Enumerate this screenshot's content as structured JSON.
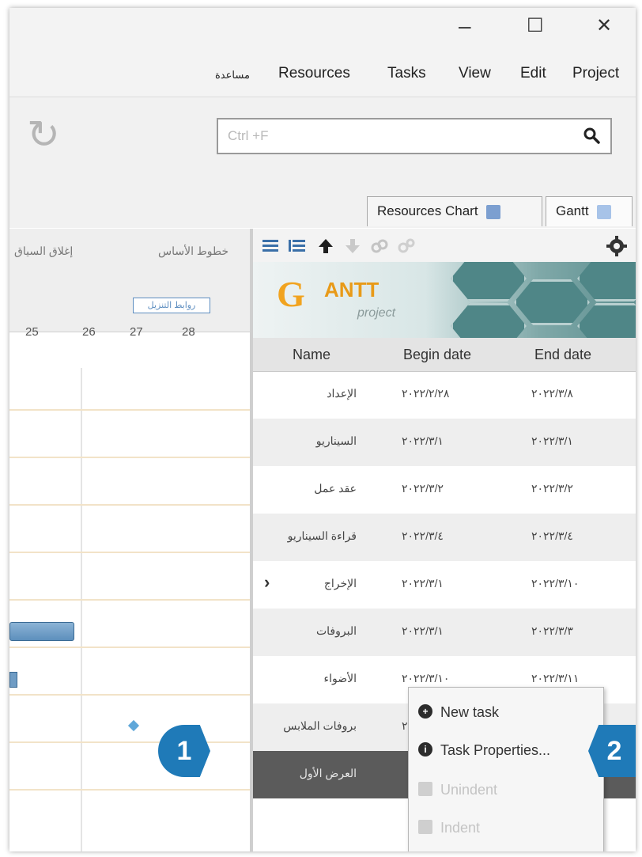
{
  "window": {
    "minimize": "–",
    "maximize": "☐",
    "close": "✕"
  },
  "menu": {
    "items": [
      "Project",
      "Edit",
      "View",
      "Tasks",
      "Resources"
    ],
    "help_label": "مساعدة"
  },
  "search": {
    "placeholder": "Ctrl +F"
  },
  "tabs": {
    "gantt": "Gantt",
    "resources_chart": "Resources Chart"
  },
  "chart": {
    "header_tabs": [
      "خطوط الأساس",
      "إغلاق السياق"
    ],
    "link_chip": "روابط التنزيل",
    "ticks": [
      "25",
      "26",
      "27",
      "28"
    ]
  },
  "table": {
    "columns": [
      "Name",
      "Begin date",
      "End date"
    ],
    "rows": [
      {
        "name": "الإعداد",
        "begin": "٢٠٢٢/٢/٢٨",
        "end": "٢٠٢٢/٣/٨"
      },
      {
        "name": "السيناريو",
        "begin": "٢٠٢٢/٣/١",
        "end": "٢٠٢٢/٣/١"
      },
      {
        "name": "عقد عمل",
        "begin": "٢٠٢٢/٣/٢",
        "end": "٢٠٢٢/٣/٢"
      },
      {
        "name": "قراءة السيناريو",
        "begin": "٢٠٢٢/٣/٤",
        "end": "٢٠٢٢/٣/٤"
      },
      {
        "name": "الإخراج",
        "begin": "٢٠٢٢/٣/١",
        "end": "٢٠٢٢/٣/١٠"
      },
      {
        "name": "البروفات",
        "begin": "٢٠٢٢/٣/١",
        "end": "٢٠٢٢/٣/٣"
      },
      {
        "name": "الأضواء",
        "begin": "٢٠٢٢/٣/١٠",
        "end": "٢٠٢٢/٣/١١"
      },
      {
        "name": "بروفات الملابس",
        "begin": "٢",
        "end": ""
      },
      {
        "name": "العرض الأول",
        "begin": "",
        "end": ""
      }
    ]
  },
  "context_menu": {
    "new_task": "New task",
    "task_properties": "Task Properties...",
    "unindent": "Unindent",
    "indent": "Indent"
  },
  "callouts": {
    "one": "1",
    "two": "2"
  },
  "logo": {
    "word": "ANTT",
    "sub": "project"
  }
}
